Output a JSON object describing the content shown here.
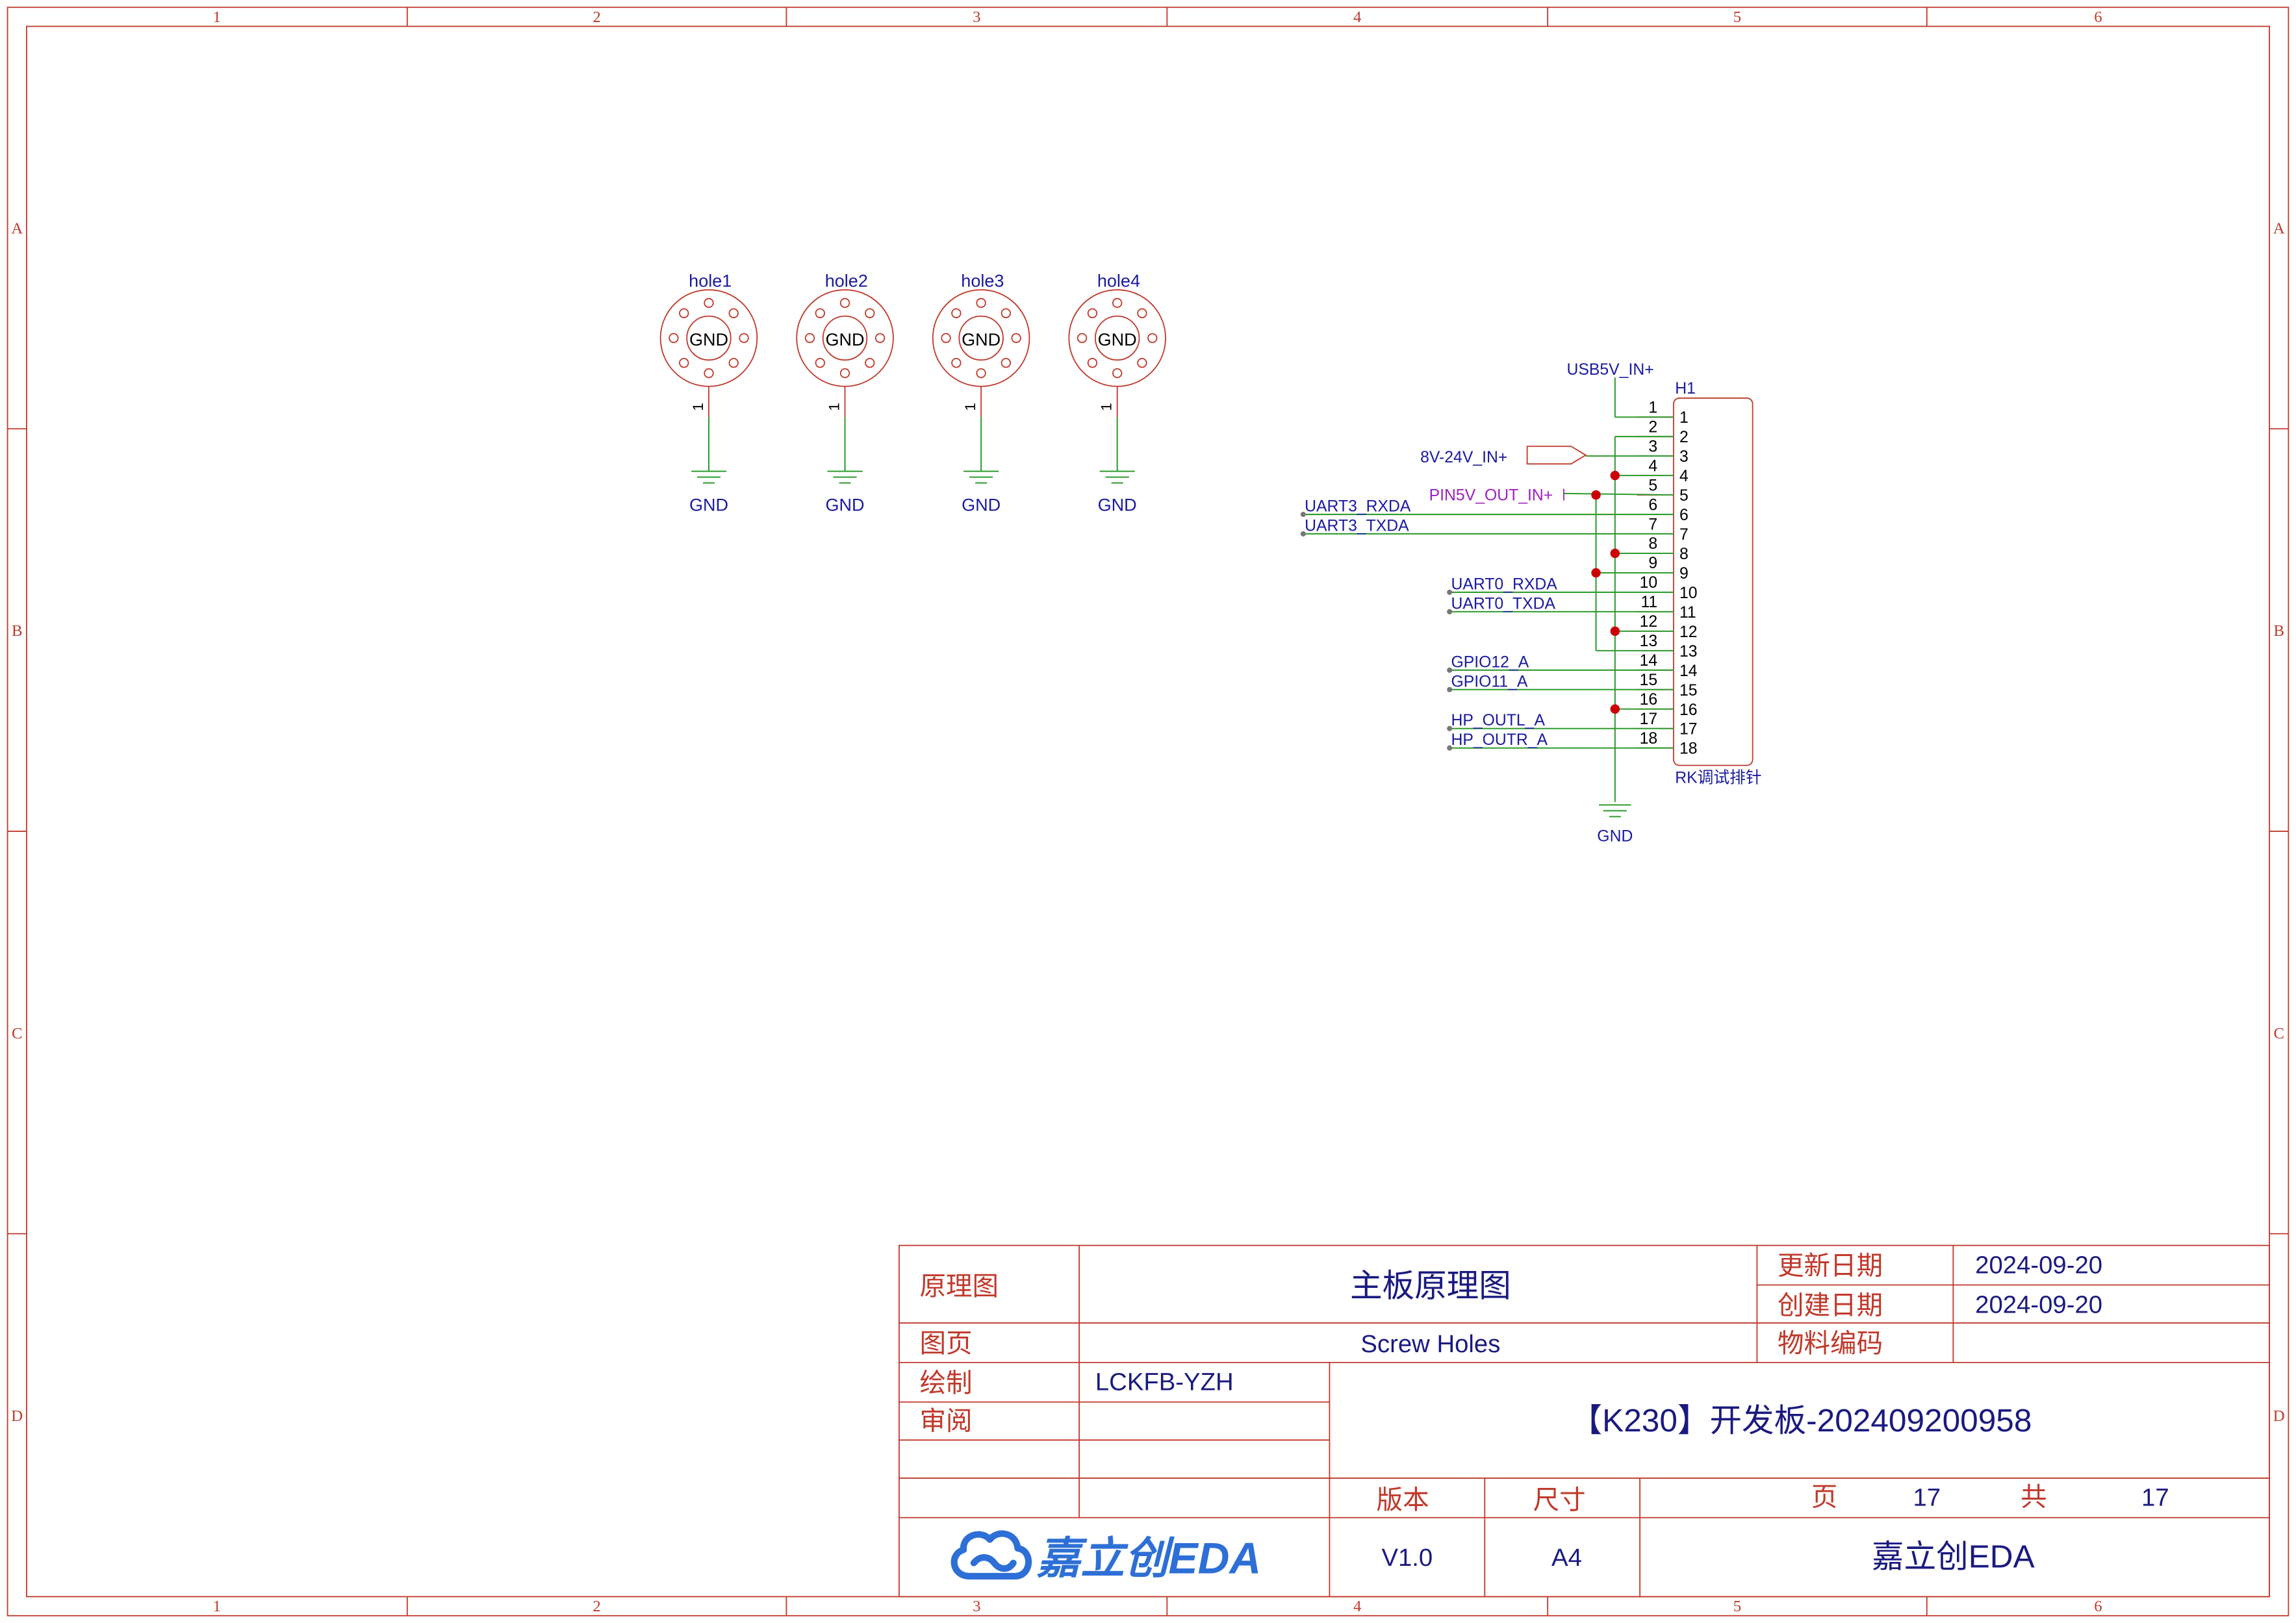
{
  "frame": {
    "columns": [
      "1",
      "2",
      "3",
      "4",
      "5",
      "6"
    ],
    "rows": [
      "A",
      "B",
      "C",
      "D"
    ],
    "colors": {
      "frame": "#c0392b",
      "wire": "#2e9c2e",
      "net_label": "#1a1aa0",
      "power_label": "#a020c0",
      "junction": "#cc0000",
      "logo_blue": "#2d6fd6"
    }
  },
  "holes": [
    {
      "ref": "hole1",
      "pad": "GND",
      "pin": "1",
      "net": "GND"
    },
    {
      "ref": "hole2",
      "pad": "GND",
      "pin": "1",
      "net": "GND"
    },
    {
      "ref": "hole3",
      "pad": "GND",
      "pin": "1",
      "net": "GND"
    },
    {
      "ref": "hole4",
      "pad": "GND",
      "pin": "1",
      "net": "GND"
    }
  ],
  "header": {
    "ref": "H1",
    "value": "RK调试排针",
    "pin_numbers": [
      "1",
      "2",
      "3",
      "4",
      "5",
      "6",
      "7",
      "8",
      "9",
      "10",
      "11",
      "12",
      "13",
      "14",
      "15",
      "16",
      "17",
      "18"
    ],
    "usb_net": "USB5V_IN+",
    "vin_net": "8V-24V_IN+",
    "pin5v_net": "PIN5V_OUT_IN+",
    "gnd": "GND",
    "net_labels": [
      "UART3_RXDA",
      "UART3_TXDA",
      "UART0_RXDA",
      "UART0_TXDA",
      "GPIO12_A",
      "GPIO11_A",
      "HP_OUTL_A",
      "HP_OUTR_A"
    ]
  },
  "title_block": {
    "labels": {
      "schematic": "原理图",
      "updated": "更新日期",
      "created": "创建日期",
      "page": "图页",
      "material": "物料编码",
      "drawn": "绘制",
      "review": "审阅",
      "version": "版本",
      "size": "尺寸",
      "page_word": "页",
      "total_word": "共"
    },
    "values": {
      "main_title": "主板原理图",
      "updated_date": "2024-09-20",
      "created_date": "2024-09-20",
      "page_name": "Screw Holes",
      "drawn_by": "LCKFB-YZH",
      "project": "【K230】开发板-202409200958",
      "version": "V1.0",
      "size": "A4",
      "page_no": "17",
      "page_total": "17",
      "company": "嘉立创EDA",
      "logo_text": "嘉立创EDA"
    }
  }
}
